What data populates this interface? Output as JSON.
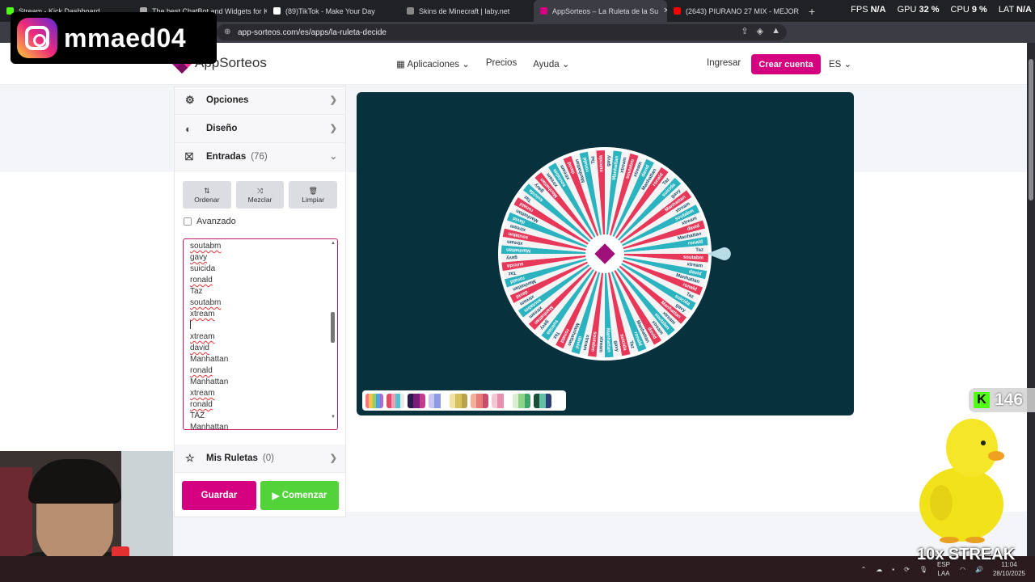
{
  "browser": {
    "tabs": [
      {
        "title": "Stream - Kick Dashboard",
        "color": "#53fc18",
        "active": false
      },
      {
        "title": "The best ChatBot and Widgets for Ki",
        "color": "#aaaaaa",
        "active": false
      },
      {
        "title": "(89)TikTok - Make Your Day",
        "color": "#ffffff",
        "active": false
      },
      {
        "title": "Skins de Minecraft | laby.net",
        "color": "#888888",
        "active": false
      },
      {
        "title": "AppSorteos – La Ruleta de la Su",
        "color": "#d4007f",
        "active": true
      },
      {
        "title": "(2643) PIURANO 27 MIX - MEJOR",
        "color": "#ff0000",
        "active": false
      }
    ],
    "new_tab": "+",
    "url": "app-sorteos.com/es/apps/la-ruleta-decide",
    "perf": [
      {
        "label": "FPS",
        "value": "N/A"
      },
      {
        "label": "GPU",
        "value": "32 %"
      },
      {
        "label": "CPU",
        "value": "9 %"
      },
      {
        "label": "LAT",
        "value": "N/A"
      }
    ]
  },
  "overlay": {
    "instagram_handle": "mmaed04",
    "kick_count": "146",
    "streak": "10x STREAK"
  },
  "nav": {
    "brand": "AppSorteos",
    "aplicaciones": "Aplicaciones",
    "precios": "Precios",
    "ayuda": "Ayuda",
    "ingresar": "Ingresar",
    "crear_cuenta": "Crear cuenta",
    "lang": "ES"
  },
  "panel": {
    "opciones": "Opciones",
    "diseno": "Diseño",
    "entradas": "Entradas",
    "entradas_count": "(76)",
    "ordenar": "Ordenar",
    "mezclar": "Mezclar",
    "limpiar": "Limpiar",
    "avanzado": "Avanzado",
    "entries": [
      "soutabm",
      "gavy",
      "suicida",
      "ronald",
      "Taz",
      "soutabm",
      "xtream",
      "",
      "xtream",
      "david",
      "Manhattan",
      "ronald",
      "Manhattan",
      "xtream",
      "ronald",
      "TAZ",
      "Manhattan"
    ],
    "mis_ruletas": "Mis Ruletas",
    "mis_ruletas_count": "(0)",
    "guardar": "Guardar",
    "comenzar": "Comenzar"
  },
  "wheel": {
    "colors": [
      "#e8385a",
      "#2bb3c0",
      "#f4f4f4"
    ],
    "center_color": "#a0107a",
    "visible_labels": [
      "soutabm",
      "xtream",
      "david",
      "Manhattan",
      "ronald",
      "Taz",
      "suicida",
      "gavy",
      "Manhattan",
      "xtream"
    ]
  },
  "taskbar": {
    "lang": "ESP",
    "lang2": "LAA",
    "time": "11:04",
    "date": "28/10/2025"
  }
}
